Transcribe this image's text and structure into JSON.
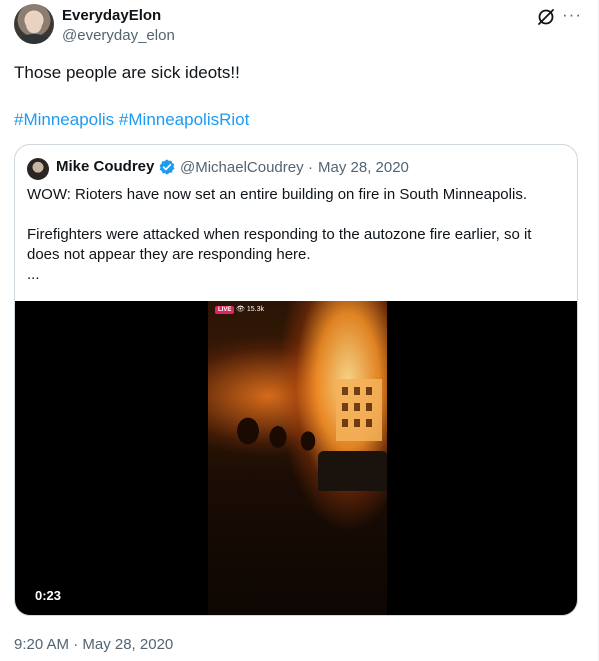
{
  "author": {
    "display_name": "EverydayElon",
    "handle": "@everyday_elon"
  },
  "tweet": {
    "text": "Those people are sick ideots!!",
    "hashtags": [
      "#Minneapolis",
      "#MinneapolisRiot"
    ],
    "timestamp": "9:20 AM · May 28, 2020"
  },
  "quoted_tweet": {
    "display_name": "Mike Coudrey",
    "handle": "@MichaelCoudrey",
    "separator": "·",
    "date": "May 28, 2020",
    "lines": [
      "WOW: Rioters have now set an entire building on fire in South Minneapolis.",
      "Firefighters were attacked when responding to the autozone fire earlier, so it",
      "does not appear they are responding here.",
      "..."
    ],
    "video": {
      "live_label": "LIVE",
      "viewer_count": "15.3k",
      "duration": "0:23"
    }
  },
  "icons": {
    "grok": "grok-icon",
    "more": "more-icon",
    "verified": "verified-badge-icon"
  },
  "colors": {
    "link": "#1d9bf0",
    "secondary_text": "#536471",
    "verified": "#1d9bf0",
    "live": "#e0245e"
  }
}
